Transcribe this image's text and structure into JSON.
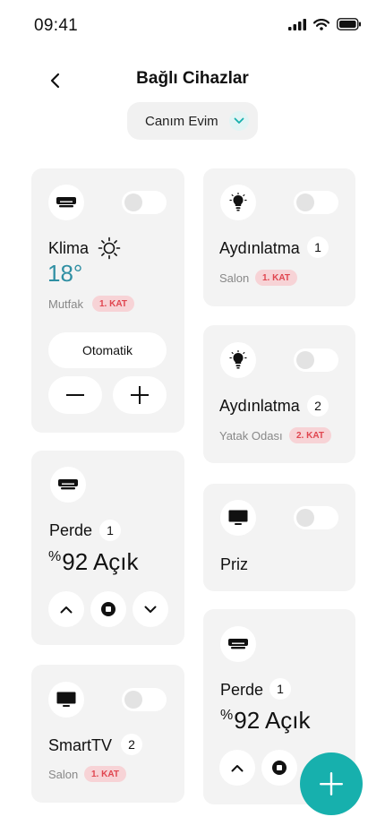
{
  "status_bar": {
    "time": "09:41"
  },
  "header": {
    "title": "Bağlı Cihazlar"
  },
  "home_selector": {
    "value": "Canım Evim"
  },
  "devices": {
    "klima": {
      "name": "Klima",
      "temperature": "18°",
      "room": "Mutfak",
      "floor": "1. KAT",
      "mode": "Otomatik",
      "on": false,
      "icon": "air-conditioner-icon"
    },
    "aydinlatma1": {
      "name": "Aydınlatma",
      "count": "1",
      "room": "Salon",
      "floor": "1. KAT",
      "on": false,
      "icon": "light-bulb-icon"
    },
    "aydinlatma2": {
      "name": "Aydınlatma",
      "count": "2",
      "room": "Yatak Odası",
      "floor": "2. KAT",
      "on": false,
      "icon": "light-bulb-icon"
    },
    "perde1": {
      "name": "Perde",
      "count": "1",
      "percent_sign": "%",
      "status": "92 Açık",
      "icon": "curtain-icon"
    },
    "priz": {
      "name": "Priz",
      "on": false,
      "icon": "monitor-icon"
    },
    "smarttv": {
      "name": "SmartTV",
      "count": "2",
      "room": "Salon",
      "floor": "1. KAT",
      "on": false,
      "icon": "tv-icon"
    },
    "perde2": {
      "name": "Perde",
      "count": "1",
      "percent_sign": "%",
      "status": "92 Açık",
      "icon": "curtain-icon"
    }
  },
  "colors": {
    "accent": "#17b0ad",
    "temperature": "#2f8fa3",
    "floor_badge_bg": "#f7d3d6",
    "floor_badge_text": "#e0454f",
    "card_bg": "#f3f3f3"
  }
}
